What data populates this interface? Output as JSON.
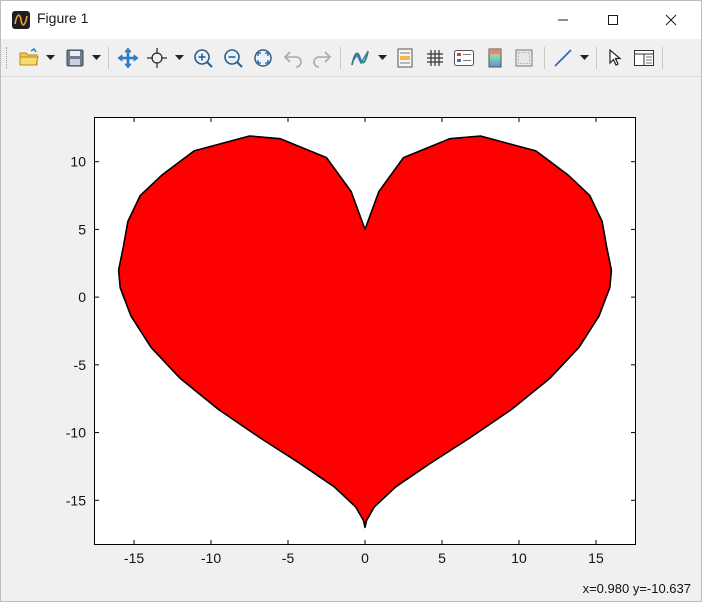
{
  "window": {
    "title": "Figure 1"
  },
  "toolbar": {
    "buttons": [
      {
        "name": "open-folder",
        "label": "Open"
      },
      {
        "name": "save",
        "label": "Save"
      },
      {
        "name": "pan",
        "label": "Pan"
      },
      {
        "name": "data-cursor",
        "label": "Data Cursor"
      },
      {
        "name": "zoom-in",
        "label": "Zoom In"
      },
      {
        "name": "zoom-out",
        "label": "Zoom Out"
      },
      {
        "name": "zoom-fit",
        "label": "Zoom to Fit"
      },
      {
        "name": "undo",
        "label": "Undo"
      },
      {
        "name": "redo",
        "label": "Redo"
      },
      {
        "name": "plot-style",
        "label": "Plot Style"
      },
      {
        "name": "insert-text",
        "label": "Text"
      },
      {
        "name": "grid",
        "label": "Grid"
      },
      {
        "name": "legend",
        "label": "Legend"
      },
      {
        "name": "colorbar",
        "label": "Colorbar"
      },
      {
        "name": "box",
        "label": "Box"
      },
      {
        "name": "line",
        "label": "Line"
      },
      {
        "name": "select",
        "label": "Select"
      },
      {
        "name": "properties",
        "label": "Properties"
      }
    ]
  },
  "status": {
    "coords": "x=0.980 y=-10.637"
  },
  "colors": {
    "fill": "#ff0000",
    "edge": "#000000",
    "axes_bg": "#ffffff"
  },
  "chart_data": {
    "type": "area",
    "title": "",
    "xlabel": "",
    "ylabel": "",
    "xlim": [
      -17.6,
      17.6
    ],
    "ylim": [
      -18.3,
      13.3
    ],
    "xticks": [
      -15,
      -10,
      -5,
      0,
      5,
      10,
      15
    ],
    "yticks": [
      -15,
      -10,
      -5,
      0,
      5,
      10
    ],
    "xtick_labels": [
      "-15",
      "-10",
      "-5",
      "0",
      "5",
      "10",
      "15"
    ],
    "ytick_labels": [
      "-15",
      "-10",
      "-5",
      "0",
      "5",
      "10"
    ],
    "grid": false,
    "series": [
      {
        "kind": "filled-polygon",
        "x": [
          0.0,
          0.1,
          0.6,
          2.0,
          4.2,
          6.8,
          9.5,
          12.0,
          13.9,
          15.2,
          15.9,
          16.0,
          15.7,
          15.4,
          14.6,
          13.2,
          11.1,
          7.5,
          5.5,
          2.5,
          0.9,
          0.0,
          -0.9,
          -2.5,
          -5.5,
          -7.5,
          -11.1,
          -13.2,
          -14.6,
          -15.4,
          -15.7,
          -16.0,
          -15.9,
          -15.2,
          -13.9,
          -12.0,
          -9.5,
          -6.8,
          -4.2,
          -2.0,
          -0.6,
          -0.1
        ],
        "y": [
          -17.0,
          -16.5,
          -15.5,
          -14.0,
          -12.3,
          -10.4,
          -8.3,
          -6.0,
          -3.7,
          -1.4,
          0.7,
          2.0,
          3.7,
          5.6,
          7.5,
          9.0,
          10.8,
          11.9,
          11.7,
          10.3,
          7.8,
          5.0,
          7.8,
          10.3,
          11.7,
          11.9,
          10.8,
          9.0,
          7.5,
          5.6,
          3.7,
          2.0,
          0.7,
          -1.4,
          -3.7,
          -6.0,
          -8.3,
          -10.4,
          -12.3,
          -14.0,
          -15.5,
          -16.5
        ]
      }
    ]
  }
}
